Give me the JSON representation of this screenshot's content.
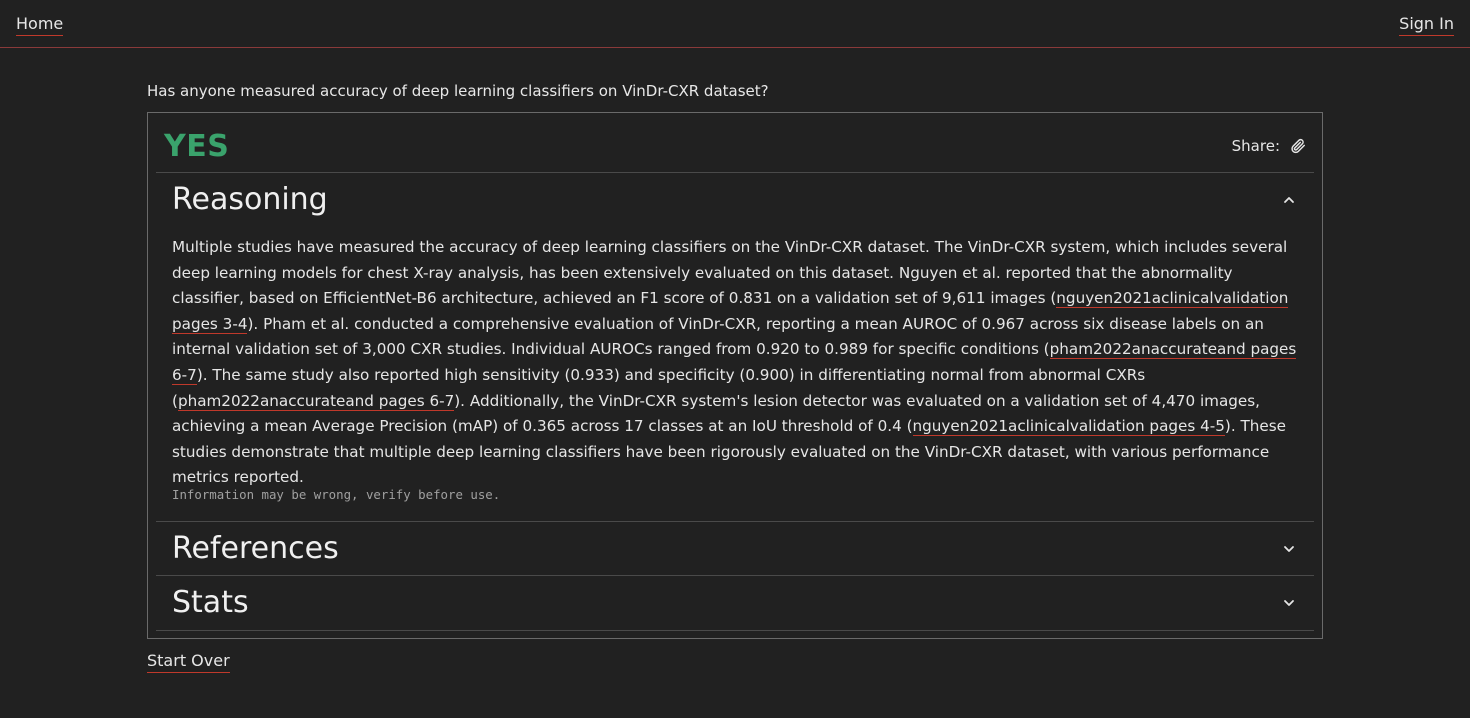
{
  "nav": {
    "home_label": "Home",
    "signin_label": "Sign In"
  },
  "question": "Has anyone measured accuracy of deep learning classifiers on VinDr-CXR dataset?",
  "answer": {
    "verdict": "YES",
    "verdict_color": "#3aa36c",
    "share_label": "Share:",
    "share_icon": "paperclip-icon"
  },
  "sections": {
    "reasoning": {
      "title": "Reasoning",
      "expanded": true,
      "chevron": "chevron-up-icon",
      "body": [
        {
          "text": "Multiple studies have measured the accuracy of deep learning classifiers on the VinDr-CXR dataset. The VinDr-CXR system, which includes several deep learning models for chest X-ray analysis, has been extensively evaluated on this dataset. Nguyen et al. reported that the abnormality classifier, based on EfficientNet-B6 architecture, achieved an F1 score of 0.831 on a validation set of 9,611 images ("
        },
        {
          "link": "nguyen2021aclinicalvalidation pages 3-4"
        },
        {
          "text": "). Pham et al. conducted a comprehensive evaluation of VinDr-CXR, reporting a mean AUROC of 0.967 across six disease labels on an internal validation set of 3,000 CXR studies. Individual AUROCs ranged from 0.920 to 0.989 for specific conditions ("
        },
        {
          "link": "pham2022anaccurateand pages 6-7"
        },
        {
          "text": "). The same study also reported high sensitivity (0.933) and specificity (0.900) in differentiating normal from abnormal CXRs ("
        },
        {
          "link": "pham2022anaccurateand pages 6-7"
        },
        {
          "text": "). Additionally, the VinDr-CXR system's lesion detector was evaluated on a validation set of 4,470 images, achieving a mean Average Precision (mAP) of 0.365 across 17 classes at an IoU threshold of 0.4 ("
        },
        {
          "link": "nguyen2021aclinicalvalidation pages 4-5"
        },
        {
          "text": "). These studies demonstrate that multiple deep learning classifiers have been rigorously evaluated on the VinDr-CXR dataset, with various performance metrics reported."
        }
      ],
      "disclaimer": "Information may be wrong, verify before use."
    },
    "references": {
      "title": "References",
      "expanded": false,
      "chevron": "chevron-down-icon"
    },
    "stats": {
      "title": "Stats",
      "expanded": false,
      "chevron": "chevron-down-icon"
    }
  },
  "footer": {
    "start_over_label": "Start Over"
  },
  "colors": {
    "background": "#212121",
    "link_underline": "#c0392b",
    "border": "#6a6a6a"
  }
}
